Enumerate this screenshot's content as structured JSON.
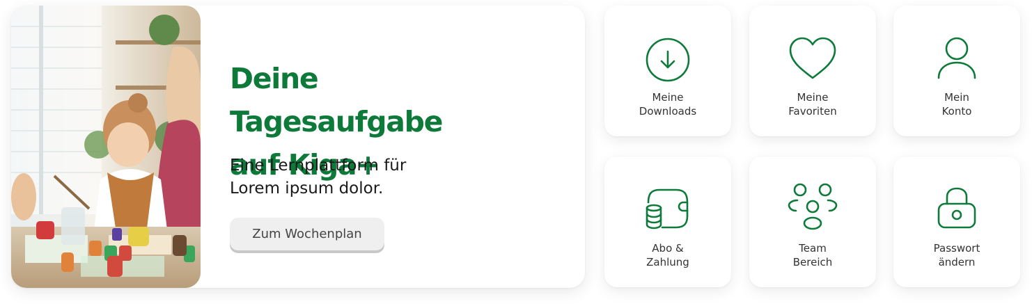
{
  "colors": {
    "brand_green": "#0d7a3a",
    "tile_bg": "#ffffff",
    "button_bg": "#efefef"
  },
  "hero": {
    "photo_icon": "kids-crafting-photo",
    "title_line1": "Deine Tagesaufgabe",
    "title_line2": "auf Kiga+",
    "subtitle_line1": "Eine Lernplattform für",
    "subtitle_line2": "Lorem ipsum dolor.",
    "button_label": "Zum Wochenplan"
  },
  "tiles": [
    {
      "icon": "download-icon",
      "line1": "Meine",
      "line2": "Downloads"
    },
    {
      "icon": "heart-icon",
      "line1": "Meine",
      "line2": "Favoriten"
    },
    {
      "icon": "user-icon",
      "line1": "Mein",
      "line2": "Konto"
    },
    {
      "icon": "wallet-icon",
      "line1": "Abo &",
      "line2": "Zahlung"
    },
    {
      "icon": "team-icon",
      "line1": "Team",
      "line2": "Bereich"
    },
    {
      "icon": "lock-icon",
      "line1": "Passwort",
      "line2": "ändern"
    }
  ]
}
